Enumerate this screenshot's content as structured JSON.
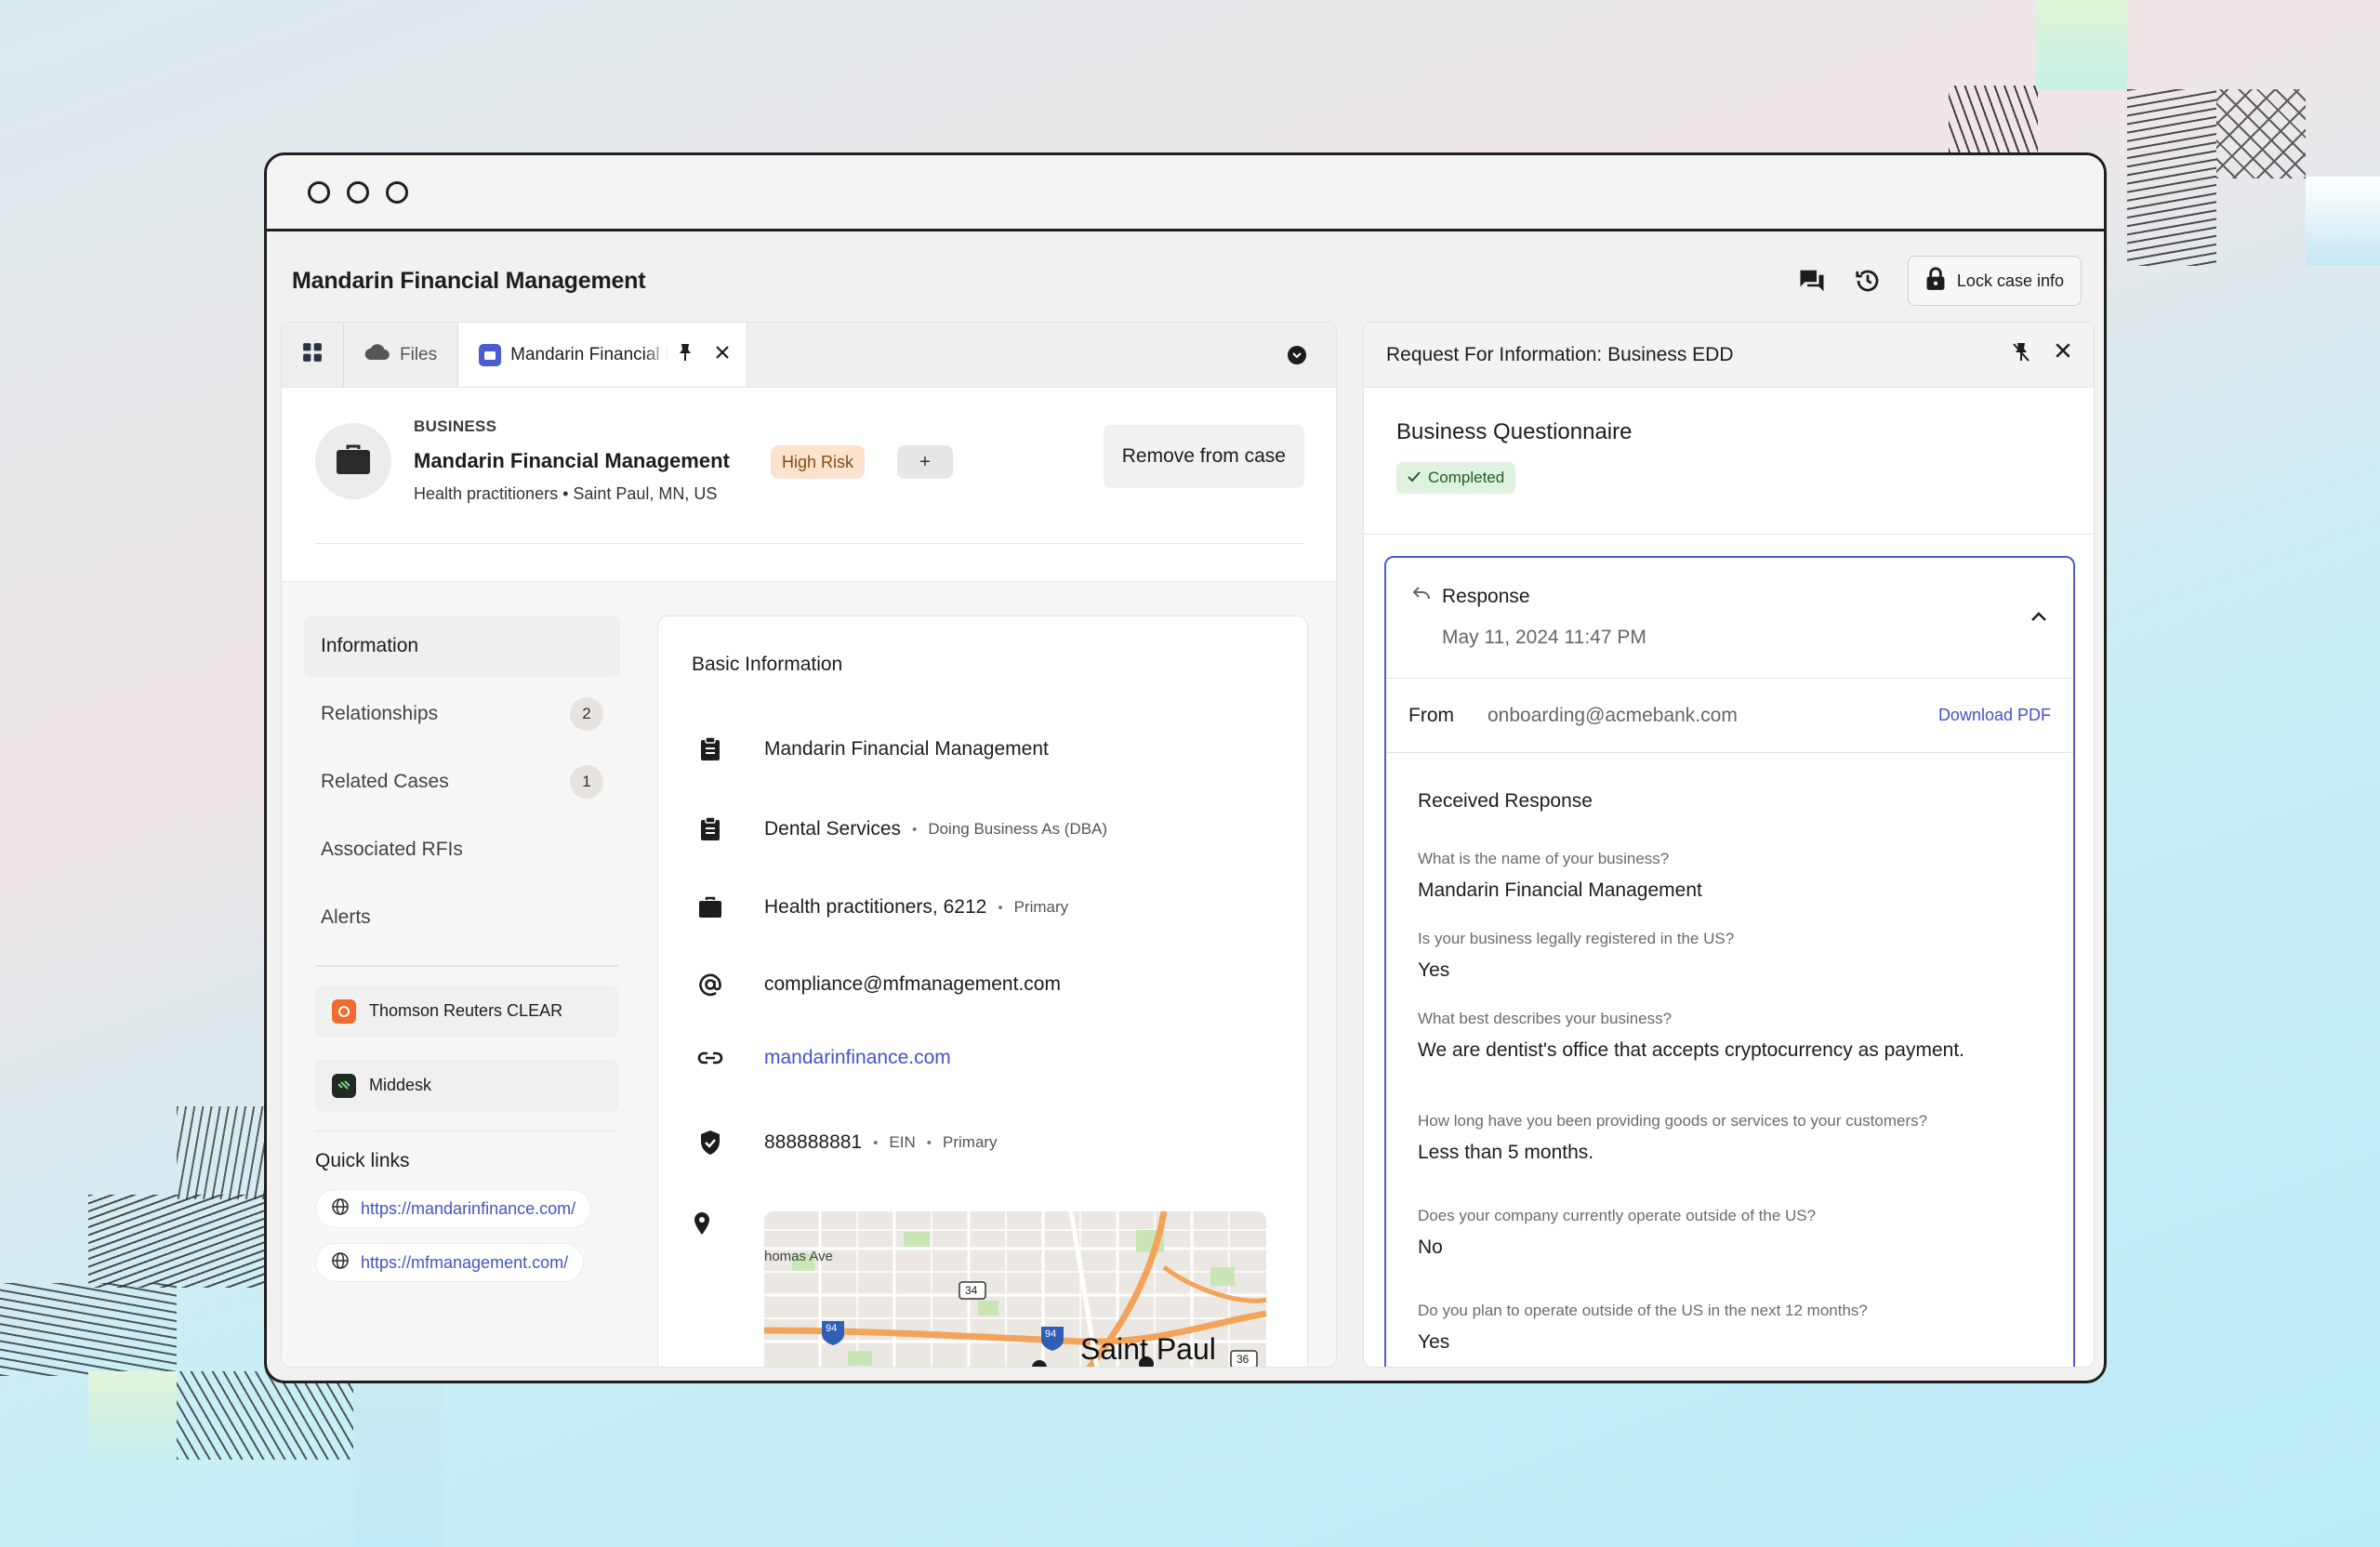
{
  "header": {
    "title": "Mandarin Financial Management",
    "lock_label": "Lock case info"
  },
  "tabs": {
    "files_label": "Files",
    "active_label": "Mandarin Financial Management"
  },
  "business": {
    "kicker": "BUSINESS",
    "name": "Mandarin Financial Management",
    "subtitle": "Health practitioners • Saint Paul, MN, US",
    "risk_badge": "High Risk",
    "add_badge": "+",
    "remove_label": "Remove from case"
  },
  "sidebar": {
    "items": [
      {
        "label": "Information",
        "count": ""
      },
      {
        "label": "Relationships",
        "count": "2"
      },
      {
        "label": "Related Cases",
        "count": "1"
      },
      {
        "label": "Associated RFIs",
        "count": ""
      },
      {
        "label": "Alerts",
        "count": ""
      }
    ],
    "integrations": [
      {
        "label": "Thomson Reuters CLEAR",
        "color": "#f26a2e"
      },
      {
        "label": "Middesk",
        "color": "#1e2a22"
      }
    ],
    "quick_links_title": "Quick links",
    "quick_links": [
      "https://mandarinfinance.com/",
      "https://mfmanagement.com/"
    ]
  },
  "basic_info": {
    "title": "Basic Information",
    "legal_name": "Mandarin Financial Management",
    "dba_name": "Dental Services",
    "dba_meta": "Doing Business As (DBA)",
    "industry": "Health practitioners, 6212",
    "industry_meta": "Primary",
    "email": "compliance@mfmanagement.com",
    "website": "mandarinfinance.com",
    "ein": "888888881",
    "ein_meta1": "EIN",
    "ein_meta2": "Primary",
    "map_street": "homas Ave",
    "map_city": "Saint Paul",
    "map_shield1": "34",
    "map_shield2": "94",
    "map_shield3": "36"
  },
  "rfi": {
    "title": "Request For Information: Business EDD",
    "questionnaire_title": "Business Questionnaire",
    "status": "Completed",
    "response_title": "Response",
    "response_date": "May 11, 2024 11:47 PM",
    "from_label": "From",
    "from_value": "onboarding@acmebank.com",
    "download_label": "Download PDF",
    "received_title": "Received Response",
    "qa": [
      {
        "q": "What is the name of your business?",
        "a": "Mandarin Financial Management"
      },
      {
        "q": "Is your business legally registered in the US?",
        "a": "Yes"
      },
      {
        "q": "What best describes your business?",
        "a": "We are dentist's office that accepts cryptocurrency as payment."
      },
      {
        "q": "How long have you been providing goods or services to your customers?",
        "a": "Less than 5 months."
      },
      {
        "q": "Does your company currently operate outside of the US?",
        "a": "No"
      },
      {
        "q": "Do you plan to operate outside of the US in the next 12 months?",
        "a": "Yes"
      }
    ]
  },
  "colors": {
    "accent": "#4a5bd4",
    "link": "#4453c7",
    "risk_bg": "#fbe3cf",
    "completed_bg": "#dff1df"
  },
  "icons": {
    "header": [
      "chat-icon",
      "history-icon",
      "lock-icon"
    ],
    "tabs": [
      "grid-icon",
      "cloud-icon",
      "app-icon",
      "pin-icon",
      "close-icon",
      "more-icon"
    ]
  }
}
